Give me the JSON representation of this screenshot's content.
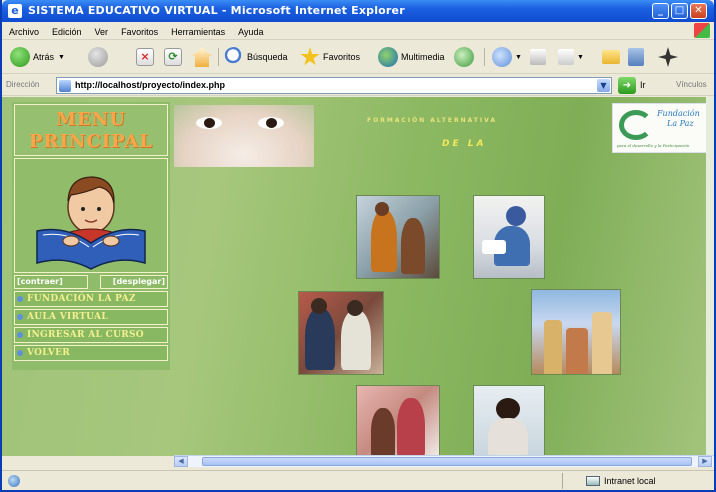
{
  "window": {
    "title": "SISTEMA EDUCATIVO VIRTUAL - Microsoft Internet Explorer",
    "app_icon": "ie-icon",
    "buttons": [
      "minimize",
      "maximize",
      "close"
    ]
  },
  "menubar": {
    "items": [
      "Archivo",
      "Edición",
      "Ver",
      "Favoritos",
      "Herramientas",
      "Ayuda"
    ]
  },
  "toolbar": {
    "back_label": "Atrás",
    "search_label": "Búsqueda",
    "favorites_label": "Favoritos",
    "media_label": "Multimedia"
  },
  "addressbar": {
    "label": "Dirección",
    "url": "http://localhost/proyecto/index.php",
    "go_label": "Ir",
    "links_label": "Vínculos"
  },
  "page": {
    "menu_title_line1": "MENU",
    "menu_title_line2": "PRINCIPAL",
    "contraer": "[contraer]",
    "desplegar": "[desplegar]",
    "nav_items": [
      "FUNDACIÓN LA PAZ",
      "AULA VIRTUAL",
      "INGRESAR AL CURSO",
      "VOLVER"
    ],
    "banner_line1": "FORMACIÓN ALTERNATIVA",
    "banner_line2": "DE LA",
    "logo_line1": "Fundación",
    "logo_line2": "La Paz",
    "logo_tagline": "para el desarrollo y la Participación"
  },
  "statusbar": {
    "zone": "Intranet local"
  },
  "colors": {
    "titlebar": "#1b5fe0",
    "page_bg": "#8fbc6a",
    "menu_title": "#f5a74a",
    "nav_text": "#f4f090"
  }
}
